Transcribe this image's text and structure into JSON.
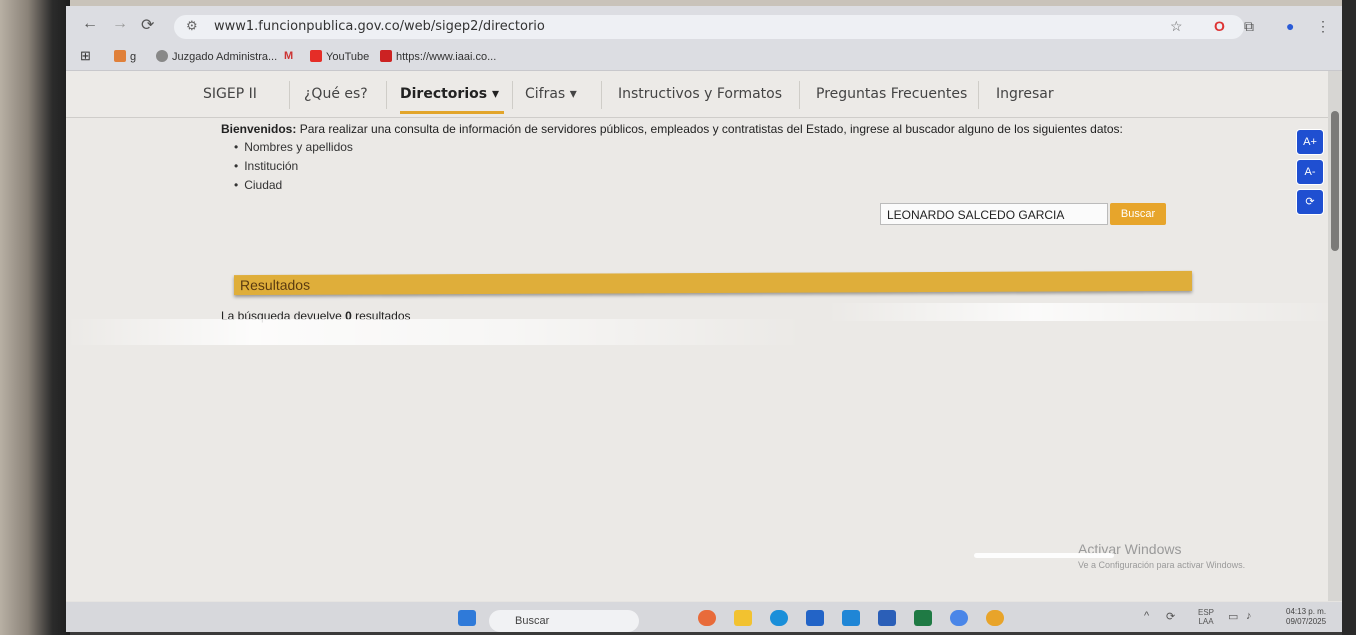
{
  "browser": {
    "url": "www1.funcionpublica.gov.co/web/sigep2/directorio",
    "bookmarks": [
      {
        "label": "g",
        "icon": "bookmark-folder-icon"
      },
      {
        "label": "Juzgado Administra...",
        "icon": "court-icon"
      },
      {
        "label": "",
        "icon": "gmail-icon"
      },
      {
        "label": "YouTube",
        "icon": "youtube-icon"
      },
      {
        "label": "https://www.iaai.co...",
        "icon": "iaai-icon"
      }
    ]
  },
  "nav": {
    "items": [
      {
        "label": "SIGEP II"
      },
      {
        "label": "¿Qué es?"
      },
      {
        "label": "Directorios",
        "dropdown": "▾",
        "active": true
      },
      {
        "label": "Cifras",
        "dropdown": "▾"
      },
      {
        "label": "Instructivos y Formatos"
      },
      {
        "label": "Preguntas Frecuentes"
      },
      {
        "label": "Ingresar"
      }
    ]
  },
  "intro": {
    "bold": "Bienvenidos:",
    "text": " Para realizar una consulta de información de servidores públicos, empleados y contratistas del Estado, ingrese al buscador alguno de los siguientes datos:",
    "bullets": [
      "Nombres y apellidos",
      "Institución",
      "Ciudad"
    ]
  },
  "search": {
    "value": "LEONARDO SALCEDO GARCIA",
    "button": "Buscar"
  },
  "results": {
    "title": "Resultados",
    "text_before": "La búsqueda devuelve ",
    "count": "0",
    "text_after": " resultados"
  },
  "accessibility": {
    "increase": "A+",
    "decrease": "A-",
    "reset": "⟳"
  },
  "watermark": {
    "title": "Activar Windows",
    "subtitle": "Ve a Configuración para activar Windows."
  },
  "taskbar": {
    "search_placeholder": "Buscar",
    "lang_top": "ESP",
    "lang_bottom": "LAA",
    "time": "04:13 p. m.",
    "date": "09/07/2025"
  },
  "colors": {
    "accent": "#e2a52a",
    "results_bar": "#dfae3a",
    "a11y_blue": "#1f4fd1"
  }
}
